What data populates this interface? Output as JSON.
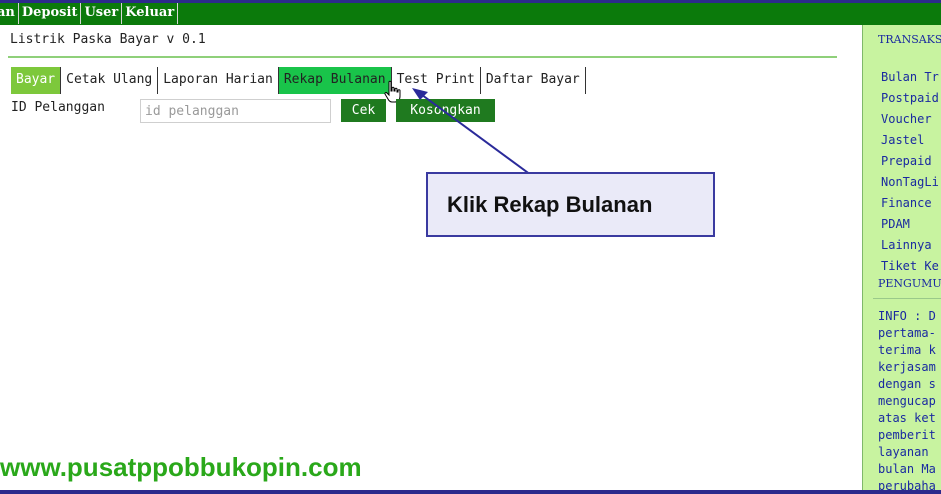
{
  "topnav": {
    "items": [
      "an",
      "Deposit",
      "User",
      "Keluar"
    ]
  },
  "app": {
    "title": "Listrik Paska Bayar v 0.1"
  },
  "tabs": [
    {
      "label": "Bayar"
    },
    {
      "label": "Cetak Ulang"
    },
    {
      "label": "Laporan Harian"
    },
    {
      "label": "Rekap Bulanan"
    },
    {
      "label": "Test Print"
    },
    {
      "label": "Daftar Bayar"
    }
  ],
  "form": {
    "id_label": "ID Pelanggan",
    "id_placeholder": "id pelanggan",
    "cek_label": "Cek",
    "kosongkan_label": "Kosongkan"
  },
  "callout": {
    "text": "Klik Rekap Bulanan"
  },
  "sidebar": {
    "header": "TRANSAKS",
    "items": [
      "Bulan Tr",
      "Postpaid",
      "Voucher",
      "Jastel",
      "Prepaid",
      "NonTagLi",
      "Finance",
      "PDAM",
      "Lainnya",
      "Tiket Ke"
    ],
    "pengumuman": "PENGUMUM",
    "info": "INFO : D\npertama-\nterima k\nkerjasam\ndengan s\nmengucap\natas ket\npemberit\nlayanan\nbulan Ma\nperubaha"
  },
  "watermark": {
    "text": "www.pusatppobbukopin.com"
  },
  "colors": {
    "nav_green": "#0b7a0b",
    "tab_active": "#7dc83b",
    "tab_highlight": "#19c44a",
    "button_green": "#1f7a1f",
    "sidebar_bg": "#c8f3a0",
    "link_blue": "#1a2aa0",
    "frame_blue": "#2c2a8c",
    "watermark_green": "#2aa81a"
  }
}
